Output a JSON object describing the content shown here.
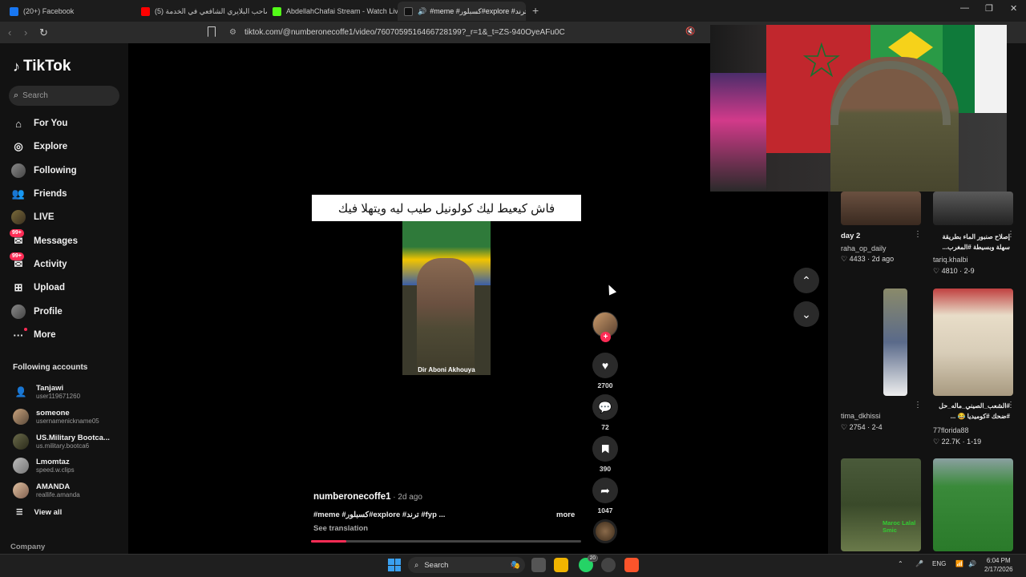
{
  "browser": {
    "tabs": [
      {
        "label": "(20+) Facebook",
        "color": "#1877f2"
      },
      {
        "label": "(5) صاحب البلايري الشافعي في الخدمة",
        "color": "#ff0000"
      },
      {
        "label": "AbdellahChafai Stream - Watch Live o",
        "color": "#53fc18"
      },
      {
        "label": "#meme #كسبلور#explore #ترند",
        "color": "#111111"
      }
    ],
    "new_tab": "+",
    "url": "tiktok.com/@numberonecoffe1/video/7607059516466728199?_r=1&_t=ZS-940OyeAFu0C",
    "back": "‹",
    "forward": "›",
    "reload": "↻",
    "minimize": "—",
    "maximize": "❐",
    "close": "✕"
  },
  "tiktok": {
    "logo": "TikTok",
    "search_placeholder": "Search",
    "nav": [
      {
        "label": "For You",
        "icon": "⌂"
      },
      {
        "label": "Explore",
        "icon": "◎"
      },
      {
        "label": "Following",
        "icon": ""
      },
      {
        "label": "Friends",
        "icon": "👥"
      },
      {
        "label": "LIVE",
        "icon": ""
      },
      {
        "label": "Messages",
        "icon": "✉",
        "badge": "99+"
      },
      {
        "label": "Activity",
        "icon": "✉",
        "badge": "99+"
      },
      {
        "label": "Upload",
        "icon": "⊞"
      },
      {
        "label": "Profile",
        "icon": ""
      },
      {
        "label": "More",
        "icon": "···"
      }
    ],
    "following_header": "Following accounts",
    "accounts": [
      {
        "name": "Tanjawi",
        "handle": "user119671260"
      },
      {
        "name": "someone",
        "handle": "usernamenickname05"
      },
      {
        "name": "US.Military Bootca...",
        "handle": "us.military.bootca6"
      },
      {
        "name": "Lmomtaz",
        "handle": "speed.w.clips"
      },
      {
        "name": "AMANDA",
        "handle": "reallife.amanda"
      }
    ],
    "view_all": "View all",
    "company": "Company"
  },
  "video": {
    "caption": "فاش كيعيط ليك كولونيل طيب ليه ويتهلا فيك",
    "watermark": "Dir Aboni Akhouya",
    "author": "numberonecoffe1",
    "date": " · 2d ago",
    "description": "#meme #كسبلور#explore #ترند #fyp ...",
    "more": "more",
    "see_translation": "See translation",
    "progress": 0.13,
    "likes": "2700",
    "comments": "72",
    "saves": "390",
    "shares": "1047"
  },
  "right_panel": {
    "cards": [
      {
        "title": "day 2",
        "user": "raha_op_daily",
        "stats": "♡ 4433 · 2d ago"
      },
      {
        "title": "إصلاح صنبور الماء بطريقة سهلة وبسيطة #المغرب...",
        "user": "tariq.khalbi",
        "stats": "♡ 4810 · 2-9"
      },
      {
        "title": "",
        "user": "tima_dkhissi",
        "stats": "♡ 2754 · 2-4"
      },
      {
        "title": "#الشعب_الصيني_ماله_حل #ضحك #كوميديا 😂 ...",
        "user": "77florida88",
        "stats": "♡ 22.7K · 1-19"
      },
      {
        "title": "Maroc Lalal Smic",
        "user": "",
        "stats": ""
      }
    ]
  },
  "taskbar": {
    "search": "Search",
    "whatsapp_badge": "20",
    "lang": "ENG",
    "time": "6:04 PM",
    "date": "2/17/2026"
  },
  "colors": {
    "accent": "#fe2c55",
    "sidebar_bg": "#121212"
  }
}
